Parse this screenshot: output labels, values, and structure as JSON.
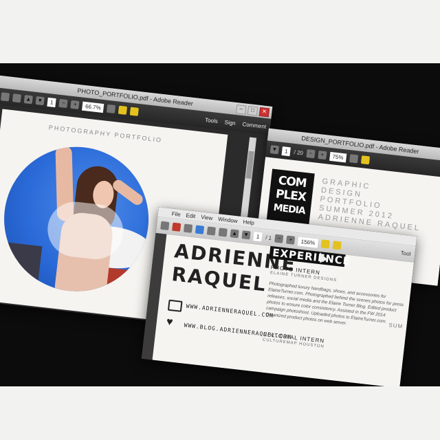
{
  "photo_window": {
    "title": "PHOTO_PORTFOLIO.pdf - Adobe Reader",
    "page_number": "1",
    "zoom": "66.7%",
    "tools": "Tools",
    "sign": "Sign",
    "comment": "Comment",
    "page_heading": "PHOTOGRAPHY PORTFOLIO"
  },
  "design_window": {
    "title": "DESIGN_PORTFOLIO.pdf - Adobe Reader",
    "page_number": "1",
    "page_total": "/ 20",
    "zoom": "75%",
    "logo_line1": "COM",
    "logo_line2": "PLEX",
    "logo_line3": "MEDIA",
    "heading_lines": [
      "GRAPHIC",
      "DESIGN",
      "PORTFOLIO",
      "SUMMER 2012",
      "ADRIENNE RAQUEL"
    ]
  },
  "resume_window": {
    "menu": [
      "File",
      "Edit",
      "View",
      "Window",
      "Help"
    ],
    "page_number": "1",
    "page_total": "/ 1",
    "zoom": "156%",
    "tools": "Tool",
    "name_first": "ADRIENNE",
    "name_last": "RAQUEL",
    "website": "WWW.ADRIENNERAQUEL.COM",
    "blog": "WWW.BLOG.ADRIENNERAQUEL.COM",
    "section_title": "EXPERIENCE",
    "job1_title": "PHOTO INTERN",
    "job1_company": "ELAINE TURNER DESIGNS",
    "job1_desc": "Photographed luxury handbags, shoes, and accessories for ElaineTurner.com. Photographed behind the scenes photos for press releases, social media and the Elaine Turner Blog. Edited product photos to ensure color consistency. Assisted in the FW 2014 campaign photoshoot. Uploaded photos to ElaineTurner.com. Organized product photos on web server.",
    "job2_title": "EDITORIAL INTERN",
    "job2_company": "CULTUREMAP HOUSTON",
    "side_label": "SUM"
  },
  "colors": {
    "monitor_bezel": "#0c0c0c",
    "toolbar": "#2e2e2e",
    "page": "#f6f4f1",
    "sky": "#2a6ad8",
    "accent_yellow": "#e3c21f"
  }
}
